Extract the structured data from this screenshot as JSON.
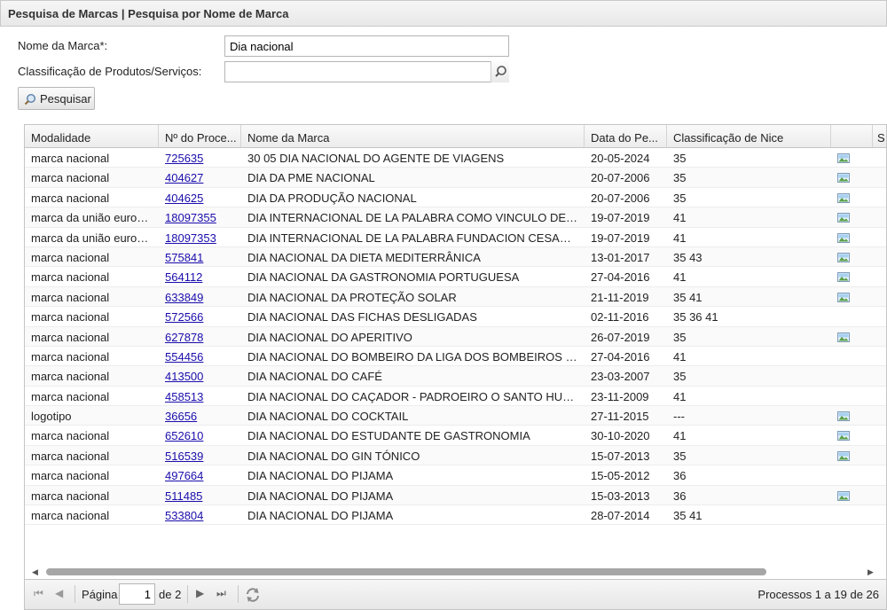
{
  "header": {
    "title": "Pesquisa de Marcas | Pesquisa por Nome de Marca"
  },
  "form": {
    "name_label": "Nome da Marca*:",
    "name_value": "Dia nacional",
    "class_label": "Classificação de Produtos/Serviços:",
    "class_value": "",
    "search_label": "Pesquisar"
  },
  "grid": {
    "columns": [
      "Modalidade",
      "Nº do Proce...",
      "Nome da Marca",
      "Data do Pe...",
      "Classificação de Nice",
      "",
      "S"
    ],
    "rows": [
      {
        "mod": "marca nacional",
        "num": "725635",
        "name": "30 05 DIA NACIONAL DO AGENTE DE VIAGENS",
        "date": "20-05-2024",
        "nice": "35",
        "img": true
      },
      {
        "mod": "marca nacional",
        "num": "404627",
        "name": "DIA DA PME NACIONAL",
        "date": "20-07-2006",
        "nice": "35",
        "img": true
      },
      {
        "mod": "marca nacional",
        "num": "404625",
        "name": "DIA DA PRODUÇÃO NACIONAL",
        "date": "20-07-2006",
        "nice": "35",
        "img": true
      },
      {
        "mod": "marca da união europeia",
        "num": "18097355",
        "name": "DIA INTERNACIONAL DE LA PALABRA COMO VINCULO DE H...",
        "date": "19-07-2019",
        "nice": "41",
        "img": true
      },
      {
        "mod": "marca da união europeia",
        "num": "18097353",
        "name": "DIA INTERNACIONAL DE LA PALABRA FUNDACION CESAR E...",
        "date": "19-07-2019",
        "nice": "41",
        "img": true
      },
      {
        "mod": "marca nacional",
        "num": "575841",
        "name": "DIA NACIONAL DA DIETA MEDITERRÂNICA",
        "date": "13-01-2017",
        "nice": "35 43",
        "img": true
      },
      {
        "mod": "marca nacional",
        "num": "564112",
        "name": "DIA NACIONAL DA GASTRONOMIA PORTUGUESA",
        "date": "27-04-2016",
        "nice": "41",
        "img": true
      },
      {
        "mod": "marca nacional",
        "num": "633849",
        "name": "DIA NACIONAL DA PROTEÇÃO SOLAR",
        "date": "21-11-2019",
        "nice": "35 41",
        "img": true
      },
      {
        "mod": "marca nacional",
        "num": "572566",
        "name": "DIA NACIONAL DAS FICHAS DESLIGADAS",
        "date": "02-11-2016",
        "nice": "35 36 41",
        "img": false
      },
      {
        "mod": "marca nacional",
        "num": "627878",
        "name": "DIA NACIONAL DO APERITIVO",
        "date": "26-07-2019",
        "nice": "35",
        "img": true
      },
      {
        "mod": "marca nacional",
        "num": "554456",
        "name": "DIA NACIONAL DO BOMBEIRO DA LIGA DOS BOMBEIROS P...",
        "date": "27-04-2016",
        "nice": "41",
        "img": false
      },
      {
        "mod": "marca nacional",
        "num": "413500",
        "name": "DIA NACIONAL DO CAFÉ",
        "date": "23-03-2007",
        "nice": "35",
        "img": false
      },
      {
        "mod": "marca nacional",
        "num": "458513",
        "name": "DIA NACIONAL DO CAÇADOR - PADROEIRO O SANTO HUBE...",
        "date": "23-11-2009",
        "nice": "41",
        "img": false
      },
      {
        "mod": "logotipo",
        "num": "36656",
        "name": "DIA NACIONAL DO COCKTAIL",
        "date": "27-11-2015",
        "nice": "---",
        "img": true
      },
      {
        "mod": "marca nacional",
        "num": "652610",
        "name": "DIA NACIONAL DO ESTUDANTE DE GASTRONOMIA",
        "date": "30-10-2020",
        "nice": "41",
        "img": true
      },
      {
        "mod": "marca nacional",
        "num": "516539",
        "name": "DIA NACIONAL DO GIN TÓNICO",
        "date": "15-07-2013",
        "nice": "35",
        "img": true
      },
      {
        "mod": "marca nacional",
        "num": "497664",
        "name": "DIA NACIONAL DO PIJAMA",
        "date": "15-05-2012",
        "nice": "36",
        "img": false
      },
      {
        "mod": "marca nacional",
        "num": "511485",
        "name": "DIA NACIONAL DO PIJAMA",
        "date": "15-03-2013",
        "nice": "36",
        "img": true
      },
      {
        "mod": "marca nacional",
        "num": "533804",
        "name": "DIA NACIONAL DO PIJAMA",
        "date": "28-07-2014",
        "nice": "35 41",
        "img": false
      }
    ]
  },
  "pager": {
    "page_label": "Página",
    "page_value": "1",
    "of_label": "de 2",
    "status": "Processos 1 a 19 de 26"
  },
  "icons": {
    "search": "magnifier-icon",
    "image": "image-thumbnail-icon",
    "first": "first-page-icon",
    "prev": "previous-page-icon",
    "next": "next-page-icon",
    "last": "last-page-icon",
    "refresh": "refresh-icon"
  }
}
